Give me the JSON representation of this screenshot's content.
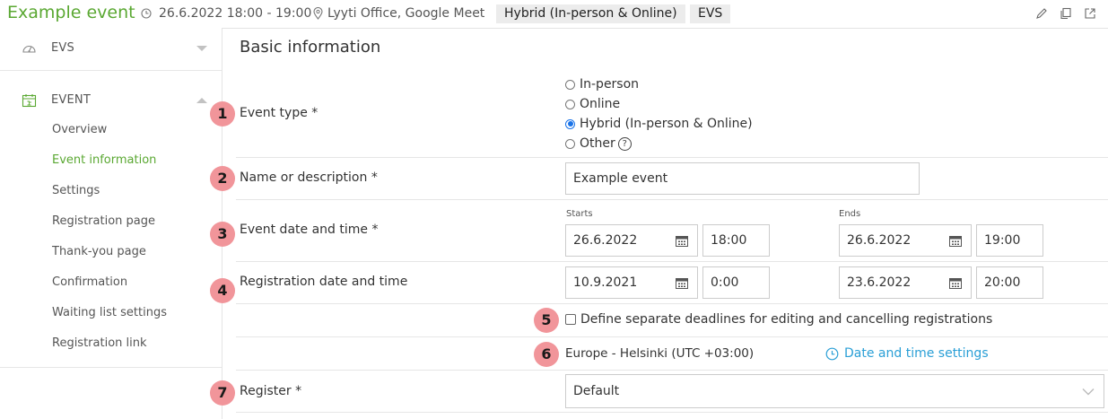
{
  "header": {
    "title": "Example event",
    "datetime": "26.6.2022 18:00 - 19:00",
    "location": "Lyyti Office, Google Meet",
    "tags": [
      "Hybrid (In-person & Online)",
      "EVS"
    ],
    "icons": [
      "clock-icon",
      "location-pin-icon",
      "pencil-icon",
      "copy-icon",
      "external-link-icon"
    ]
  },
  "sidebar": {
    "groups": [
      {
        "label": "EVS",
        "icon": "gauge-icon",
        "expanded": false
      },
      {
        "label": "EVENT",
        "icon": "calendar-icon",
        "expanded": true
      }
    ],
    "items": [
      "Overview",
      "Event information",
      "Settings",
      "Registration page",
      "Thank-you page",
      "Confirmation",
      "Waiting list settings",
      "Registration link"
    ],
    "active_item": "Event information",
    "accent_color": "#5aa832"
  },
  "main": {
    "section_title": "Basic information",
    "badge_color": "#f1959a",
    "rows": {
      "event_type": {
        "badge": "1",
        "label": "Event type *",
        "options": [
          "In-person",
          "Online",
          "Hybrid (In-person & Online)",
          "Other"
        ],
        "selected": "Hybrid (In-person & Online)"
      },
      "name": {
        "badge": "2",
        "label": "Name or description *",
        "value": "Example event"
      },
      "event_datetime": {
        "badge": "3",
        "label": "Event date and time *",
        "starts_label": "Starts",
        "ends_label": "Ends",
        "start_date": "26.6.2022",
        "start_time": "18:00",
        "end_date": "26.6.2022",
        "end_time": "19:00"
      },
      "registration_datetime": {
        "badge": "4",
        "label": "Registration date and time",
        "start_date": "10.9.2021",
        "start_time": "0:00",
        "end_date": "23.6.2022",
        "end_time": "20:00"
      },
      "deadlines": {
        "badge": "5",
        "checkbox_label": "Define separate deadlines for editing and cancelling registrations",
        "checked": false
      },
      "timezone": {
        "badge": "6",
        "value": "Europe - Helsinki (UTC +03:00)",
        "link": "Date and time settings",
        "link_color": "#2a9fd6"
      },
      "register": {
        "badge": "7",
        "label": "Register *",
        "value": "Default"
      }
    }
  }
}
